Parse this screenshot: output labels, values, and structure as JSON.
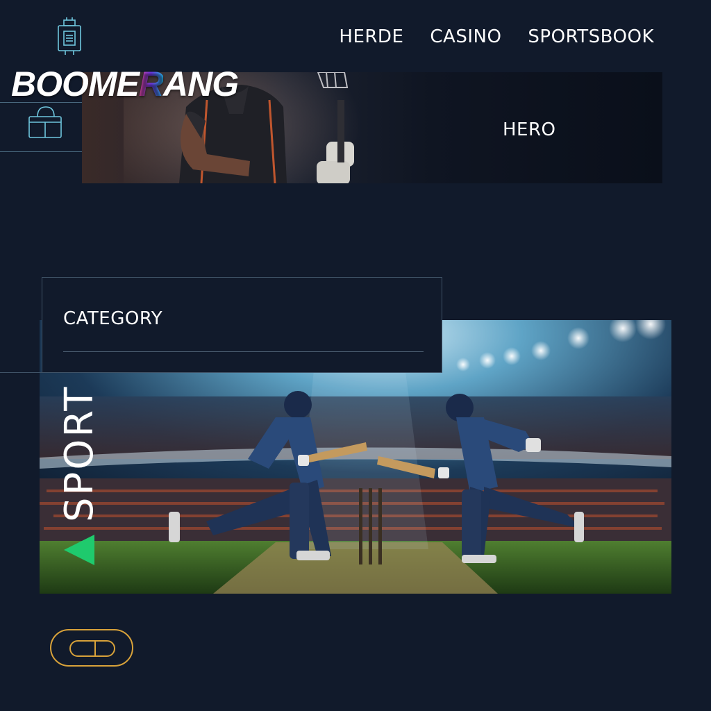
{
  "brand": {
    "logo_text_pre": "BOOME",
    "logo_text_accent": "R",
    "logo_text_post": "ANG"
  },
  "nav": {
    "items": [
      "HERDE",
      "CASINO",
      "SPORTSBOOK"
    ]
  },
  "hero": {
    "label": "HERO"
  },
  "category": {
    "label": "CATEGORY"
  },
  "sport": {
    "label": "SPORT"
  },
  "colors": {
    "background": "#111a2b",
    "accent_green": "#1fca6d",
    "toggle_gold": "#d8a23a",
    "rail": "#4a6a80"
  },
  "icons": {
    "app": "app-box-icon",
    "bag": "shopping-bag-icon",
    "play": "play-arrow-icon",
    "toggle": "toggle-switch-icon"
  }
}
